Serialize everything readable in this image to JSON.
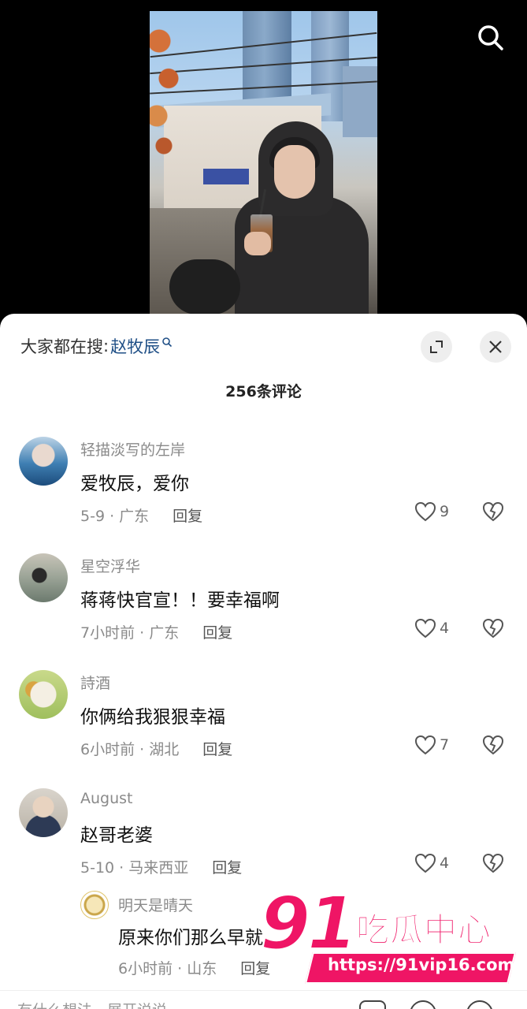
{
  "trending": {
    "prefix": "大家都在搜",
    "separator": ":",
    "keyword": "赵牧辰"
  },
  "comment_count": "256条评论",
  "comments": [
    {
      "user": "轻描淡写的左岸",
      "text": "爱牧辰，爱你",
      "time_loc": "5-9 · 广东",
      "reply": "回复",
      "likes": "9"
    },
    {
      "user": "星空浮华",
      "text": "蒋蒋快官宣！！要幸福啊",
      "time_loc": "7小时前 · 广东",
      "reply": "回复",
      "likes": "4"
    },
    {
      "user": "詩酒",
      "text": "你俩给我狠狠幸福",
      "time_loc": "6小时前 · 湖北",
      "reply": "回复",
      "likes": "7"
    },
    {
      "user": "August",
      "text": "赵哥老婆",
      "time_loc": "5-10 · 马来西亚",
      "reply": "回复",
      "likes": "4"
    }
  ],
  "sub_reply": {
    "user": "明天是晴天",
    "text": "原来你们那么早就",
    "time_loc": "6小时前 · 山东",
    "reply": "回复"
  },
  "bottom_input": {
    "placeholder": "有什么想法，展开说说"
  },
  "watermark": {
    "big": "91",
    "name": "吃瓜中心",
    "url": "https://91vip16.com"
  },
  "colors": {
    "accent": "#ef1565",
    "keyword": "#1f4f86"
  }
}
